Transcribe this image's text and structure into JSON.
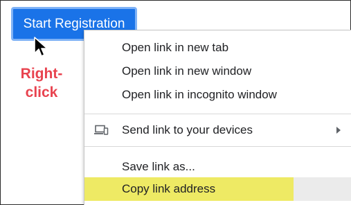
{
  "button": {
    "label": "Start Registration"
  },
  "annotation": {
    "line1": "Right-",
    "line2": "click",
    "color": "#e8434f"
  },
  "context_menu": {
    "items": [
      {
        "label": "Open link in new tab"
      },
      {
        "label": "Open link in new window"
      },
      {
        "label": "Open link in incognito window"
      },
      {
        "label": "Send link to your devices",
        "icon": "devices-icon",
        "submenu": true
      },
      {
        "label": "Save link as..."
      },
      {
        "label": "Copy link address",
        "highlighted": true
      }
    ]
  },
  "colors": {
    "button": "#1a73e8",
    "highlight": "#eeea64",
    "annotation": "#e8434f"
  }
}
